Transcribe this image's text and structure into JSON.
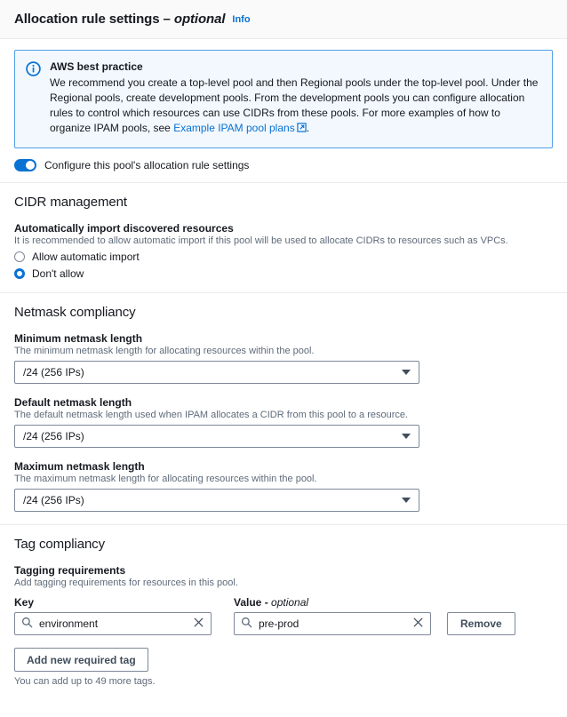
{
  "header": {
    "title": "Allocation rule settings",
    "separator": "–",
    "optional": "optional",
    "info_label": "Info"
  },
  "alert": {
    "icon": "info-circle-icon",
    "heading": "AWS best practice",
    "text_before_link": "We recommend you create a top-level pool and then Regional pools under the top-level pool. Under the Regional pools, create development pools. From the development pools you can configure allocation rules to control which resources can use CIDRs from these pools. For more examples of how to organize IPAM pools, see ",
    "link_label": "Example IPAM pool plans",
    "text_after_link": ".",
    "border_color": "#539fe5",
    "background_color": "#f2f8fd"
  },
  "toggle": {
    "label": "Configure this pool's allocation rule settings",
    "checked": true,
    "on_color": "#0972d3"
  },
  "cidr_management": {
    "title": "CIDR management",
    "auto_import": {
      "label": "Automatically import discovered resources",
      "description": "It is recommended to allow automatic import if this pool will be used to allocate CIDRs to resources such as VPCs.",
      "options": [
        {
          "label": "Allow automatic import",
          "checked": false
        },
        {
          "label": "Don't allow",
          "checked": true
        }
      ]
    }
  },
  "netmask_compliancy": {
    "title": "Netmask compliancy",
    "fields": [
      {
        "label": "Minimum netmask length",
        "description": "The minimum netmask length for allocating resources within the pool.",
        "value": "/24 (256 IPs)"
      },
      {
        "label": "Default netmask length",
        "description": "The default netmask length used when IPAM allocates a CIDR from this pool to a resource.",
        "value": "/24 (256 IPs)"
      },
      {
        "label": "Maximum netmask length",
        "description": "The maximum netmask length for allocating resources within the pool.",
        "value": "/24 (256 IPs)"
      }
    ]
  },
  "tag_compliancy": {
    "title": "Tag compliancy",
    "tagging": {
      "label": "Tagging requirements",
      "description": "Add tagging requirements for resources in this pool."
    },
    "columns": {
      "key": "Key",
      "value": "Value -",
      "value_optional": "optional"
    },
    "rows": [
      {
        "key_value": "environment",
        "key_placeholder": "environment",
        "value_value": "pre-prod",
        "value_placeholder": "pre-prod",
        "remove_label": "Remove"
      }
    ],
    "add_button_label": "Add new required tag",
    "footnote": "You can add up to 49 more tags."
  },
  "accent_color": "#0972d3"
}
